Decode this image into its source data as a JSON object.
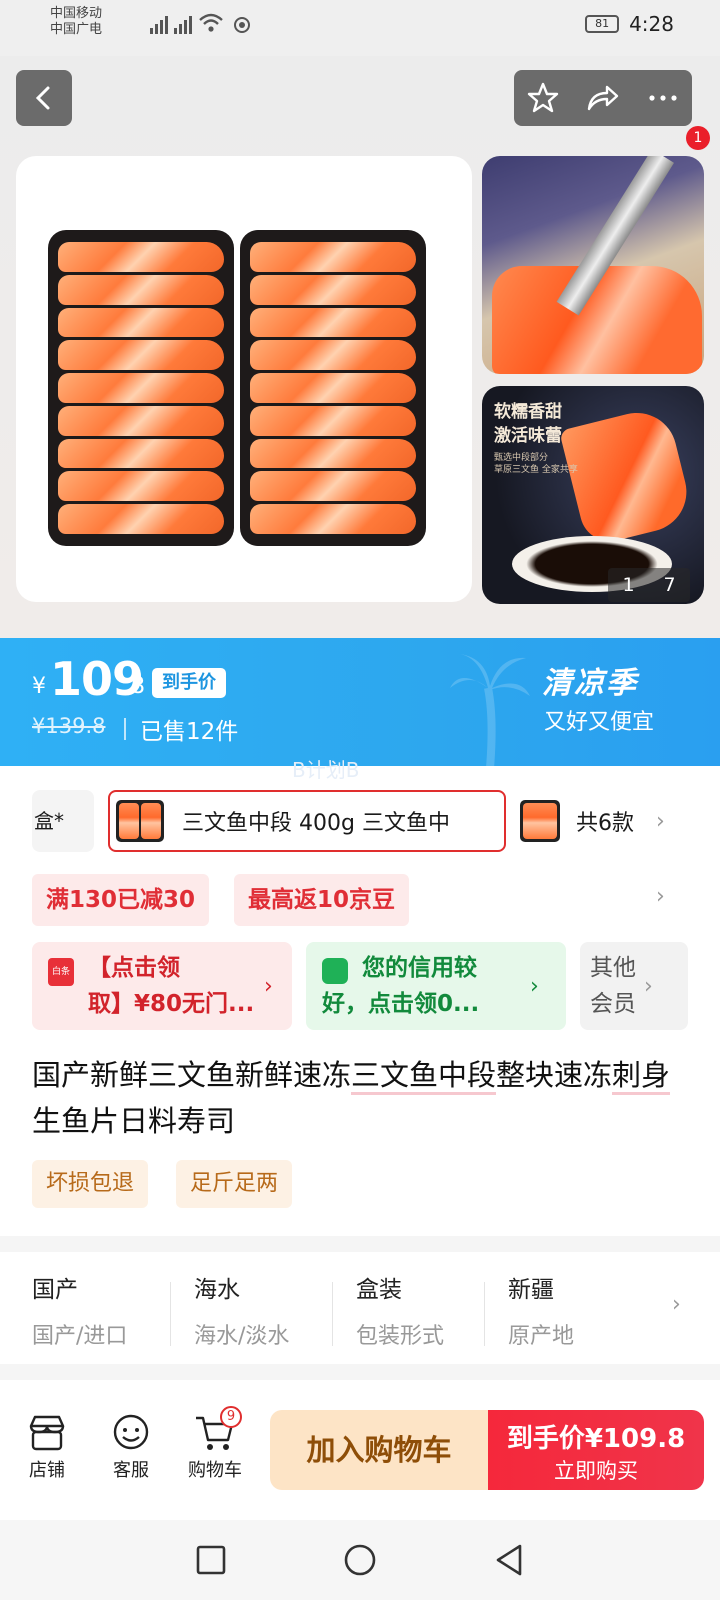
{
  "status_bar": {
    "carrier1": "中国移动",
    "carrier2": "中国广电",
    "battery": "81",
    "time": "4:28"
  },
  "header": {
    "notification_count": "1",
    "icons": [
      "back-icon",
      "star-icon",
      "share-icon",
      "more-icon"
    ]
  },
  "gallery": {
    "thumb2_text1": "软糯香甜",
    "thumb2_text2": "激活味蕾",
    "thumb2_small": "甄选中段部分",
    "thumb2_small2": "草原三文鱼 全家共享",
    "page_current": "1",
    "page_total": "7"
  },
  "price": {
    "currency": "¥",
    "integer": "109",
    "decimal": ".8",
    "tag": "到手价",
    "original": "¥139.8",
    "sold": "已售12件",
    "promo_title": "清凉季",
    "promo_sub": "又好又便宜",
    "watermark": "B计划B"
  },
  "variants": {
    "cut_label": "盒*",
    "selected": "三文鱼中段 400g 三文鱼中",
    "count": "共6款"
  },
  "coupons": {
    "full_reduction": "满130已减30",
    "jd_beans": "最高返10京豆",
    "card1_line1": "【点击领",
    "card1_line2": "取】¥80无门...",
    "card1_icon_text": "白条",
    "card2_line1": "您的信用较",
    "card2_line2": "好，点击领0...",
    "card3_line1": "其他",
    "card3_line2": "会员"
  },
  "product": {
    "title_part1": "国产新鲜三文鱼新鲜速冻",
    "title_part2": "三文鱼中段",
    "title_part3": "整块速冻",
    "title_part4": "刺身",
    "title_part5": "生鱼片日料寿司",
    "services": [
      "坏损包退",
      "足斤足两"
    ]
  },
  "attributes": [
    {
      "value": "国产",
      "key": "国产/进口"
    },
    {
      "value": "海水",
      "key": "海水/淡水"
    },
    {
      "value": "盒装",
      "key": "包装形式"
    },
    {
      "value": "新疆",
      "key": "原产地"
    }
  ],
  "bottom_bar": {
    "store": "店铺",
    "service": "客服",
    "cart": "购物车",
    "cart_count": "9",
    "add_to_cart": "加入购物车",
    "buy_price": "到手价¥109.8",
    "buy_now": "立即购买"
  },
  "colors": {
    "price_banner": "#2da7ee",
    "accent_red": "#e02e2e",
    "buy_button": "#f5283b",
    "cart_button": "#fde4c6"
  }
}
